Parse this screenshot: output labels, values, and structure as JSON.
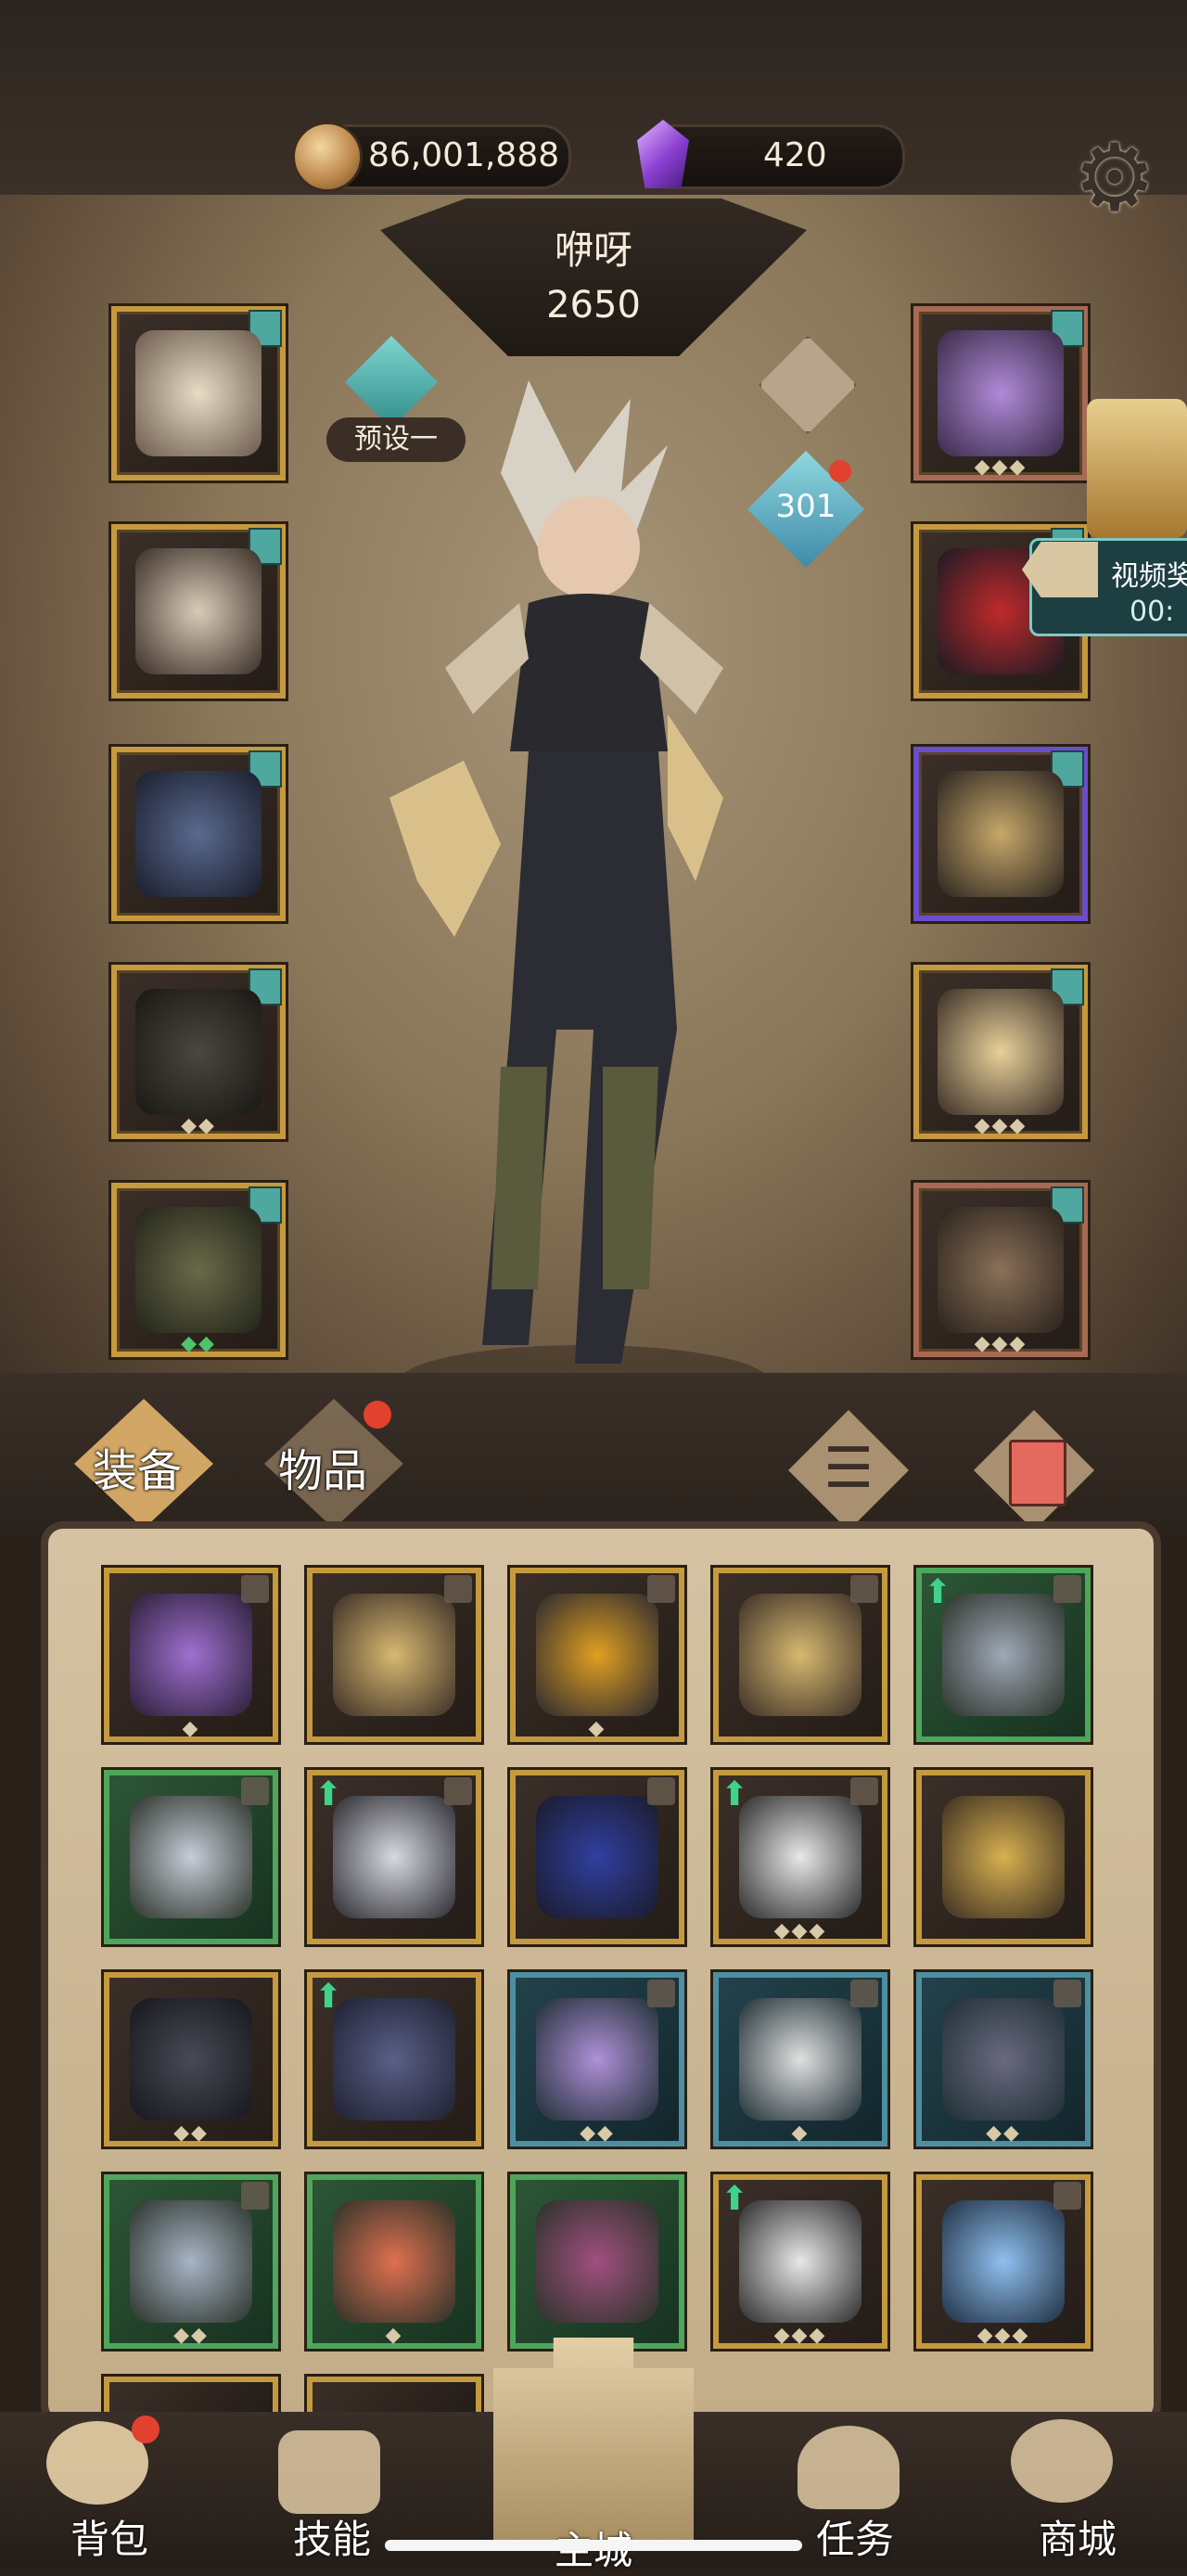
{
  "header": {
    "gold_amount": "86,001,888",
    "gem_amount": "420"
  },
  "character": {
    "name": "咿呀",
    "power": "2650",
    "level": "301",
    "preset_label": "预设一"
  },
  "event": {
    "video_label": "视频奖",
    "video_timer": "00:"
  },
  "tabs": {
    "equip": "装备",
    "items": "物品"
  },
  "bottom_nav": {
    "bag": "背包",
    "skills": "技能",
    "city": "主城",
    "quests": "任务",
    "shop": "商城"
  },
  "colors": {
    "gold_frame": "#c59a3f",
    "green_frame": "#4ea65a",
    "blue_frame": "#4d8fa0",
    "notification": "#e2412e"
  },
  "icons": {
    "settings": "gear-icon",
    "gold": "coin-icon",
    "gem": "purple-gem-icon",
    "trash": "trash-icon",
    "sort": "sort-icon"
  }
}
